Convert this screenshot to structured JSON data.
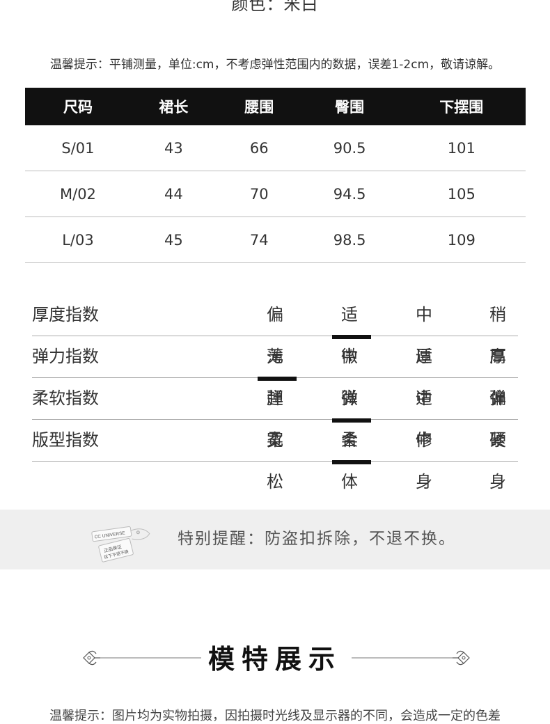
{
  "color_line": "颜色：米白",
  "tip": "温馨提示：平铺测量，单位:cm，不考虑弹性范围内的数据，误差1-2cm，敬请谅解。",
  "size_table": {
    "headers": [
      "尺码",
      "裙长",
      "腰围",
      "臀围",
      "下摆围"
    ],
    "rows": [
      [
        "S/01",
        "43",
        "66",
        "90.5",
        "101"
      ],
      [
        "M/02",
        "44",
        "70",
        "94.5",
        "105"
      ],
      [
        "L/03",
        "45",
        "74",
        "98.5",
        "109"
      ]
    ]
  },
  "indices": [
    {
      "label": "厚度指数",
      "options": [
        "偏薄",
        "适中",
        "中厚",
        "稍厚"
      ],
      "selected": 1
    },
    {
      "label": "弹力指数",
      "options": [
        "无弹",
        "微弹",
        "适中",
        "高弹"
      ],
      "selected": 0
    },
    {
      "label": "柔软指数",
      "options": [
        "超柔",
        "微柔",
        "适中",
        "偏硬"
      ],
      "selected": 1
    },
    {
      "label": "版型指数",
      "options": [
        "宽松",
        "合体",
        "修身",
        "紧身"
      ],
      "selected": 1
    }
  ],
  "notice": {
    "text": "特别提醒：防盗扣拆除，不退不换。",
    "tag_brand": "CC UNIVERSE",
    "tag_line1": "正品保证",
    "tag_line2": "拆下不退不换"
  },
  "section_title": "模特展示",
  "bottom_tip": "温馨提示：图片均为实物拍摄，因拍摄时光线及显示器的不同，会造成一定的色差"
}
